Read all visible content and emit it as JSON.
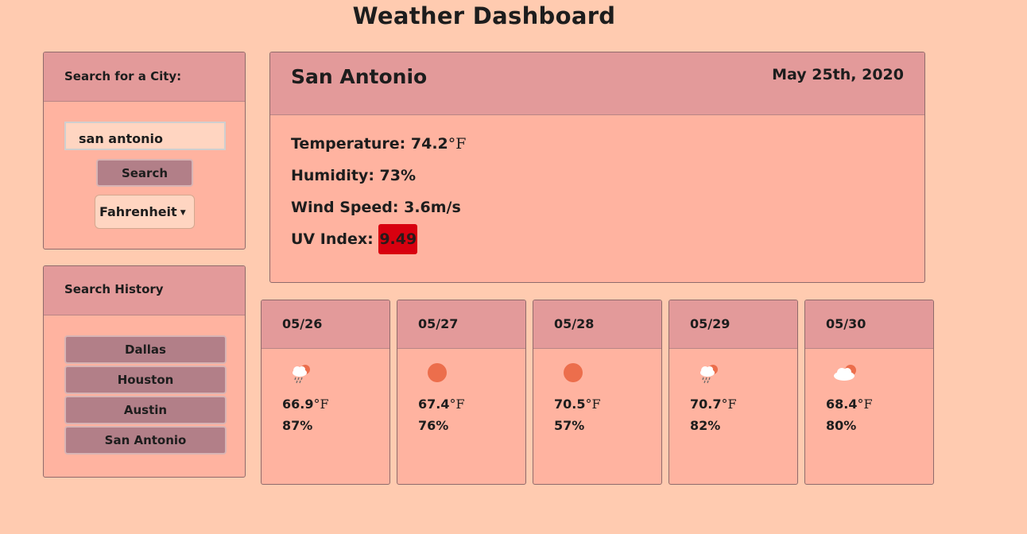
{
  "title": "Weather Dashboard",
  "search": {
    "heading": "Search for a City:",
    "input_value": "san antonio",
    "button_label": "Search",
    "unit_selected": "Fahrenheit"
  },
  "history": {
    "heading": "Search History",
    "items": [
      "Dallas",
      "Houston",
      "Austin",
      "San Antonio"
    ]
  },
  "current": {
    "city": "San Antonio",
    "date": "May 25th, 2020",
    "temperature_label": "Temperature: ",
    "temperature_value": "74.2",
    "temperature_unit": "°F",
    "humidity_label": "Humidity: ",
    "humidity_value": "73%",
    "wind_label": "Wind Speed: ",
    "wind_value": "3.6m/s",
    "uv_label": "UV Index: ",
    "uv_value": "9.49",
    "uv_color": "#d8000f"
  },
  "forecast": [
    {
      "date": "05/26",
      "icon": "rain-sun-icon",
      "temp": "66.9",
      "unit": "°F",
      "humidity": "87%"
    },
    {
      "date": "05/27",
      "icon": "sun-icon",
      "temp": "67.4",
      "unit": "°F",
      "humidity": "76%"
    },
    {
      "date": "05/28",
      "icon": "sun-icon",
      "temp": "70.5",
      "unit": "°F",
      "humidity": "57%"
    },
    {
      "date": "05/29",
      "icon": "rain-sun-icon",
      "temp": "70.7",
      "unit": "°F",
      "humidity": "82%"
    },
    {
      "date": "05/30",
      "icon": "cloud-sun-icon",
      "temp": "68.4",
      "unit": "°F",
      "humidity": "80%"
    }
  ],
  "colors": {
    "background": "#ffcbb0",
    "card": "#ffb3a0",
    "card_header": "#e39a9a",
    "button": "#b27f88",
    "sun": "#ec6e4c"
  }
}
